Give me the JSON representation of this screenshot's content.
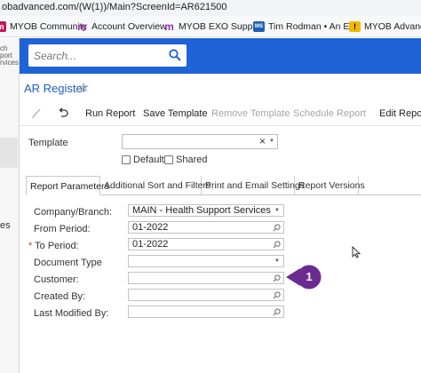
{
  "browser": {
    "url": "obadvanced.com/(W(1))/Main?ScreenId=AR621500",
    "bookmarks": [
      {
        "label": "MYOB Community",
        "icon": "myob-icon"
      },
      {
        "label": "Account Overview",
        "icon": "myob-icon"
      },
      {
        "label": "MYOB EXO Support",
        "icon": "myob-icon"
      },
      {
        "label": "Tim Rodman • An E...",
        "icon": "ms-icon"
      },
      {
        "label": "MYOB Advanced",
        "icon": "warning-icon"
      }
    ]
  },
  "sidebar": {
    "logo_lines": [
      "ch",
      "port",
      "rvices"
    ],
    "item_fragment": "es"
  },
  "header": {
    "search_placeholder": "Search..."
  },
  "page": {
    "title": "AR Register"
  },
  "toolbar": {
    "run_report": "Run Report",
    "save_template": "Save Template",
    "remove_template": "Remove Template",
    "schedule_report": "Schedule Report",
    "edit_report": "Edit Report"
  },
  "template": {
    "label": "Template",
    "value": "",
    "default_label": "Default",
    "shared_label": "Shared"
  },
  "tabs": [
    {
      "label": "Report Parameters",
      "active": true
    },
    {
      "label": "Additional Sort and Filters",
      "active": false
    },
    {
      "label": "Print and Email Settings",
      "active": false
    },
    {
      "label": "Report Versions",
      "active": false
    }
  ],
  "form": {
    "company_branch": {
      "label": "Company/Branch:",
      "value": "MAIN - Health Support Services"
    },
    "from_period": {
      "label": "From Period:",
      "value": "01-2022"
    },
    "to_period": {
      "label": "To Period:",
      "required_mark": "*",
      "value": "01-2022"
    },
    "document_type": {
      "label": "Document Type",
      "value": ""
    },
    "customer": {
      "label": "Customer:",
      "value": ""
    },
    "created_by": {
      "label": "Created By:",
      "value": ""
    },
    "last_modified_by": {
      "label": "Last Modified By:",
      "value": ""
    }
  },
  "callout": {
    "number": "1",
    "color": "#6a2c91"
  },
  "colors": {
    "header_blue": "#1f63d6",
    "title_blue": "#1f5fbf"
  }
}
